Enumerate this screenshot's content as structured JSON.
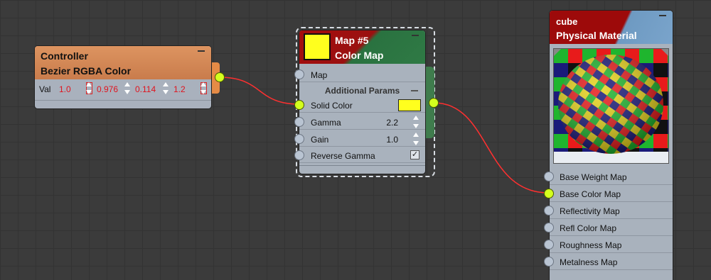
{
  "controller_node": {
    "title": "Controller",
    "subtitle": "Bezier RGBA Color",
    "val_label": "Val",
    "values": [
      "1.0",
      "0.976",
      "0.114",
      "1.2"
    ]
  },
  "color_map_node": {
    "title": "Map #5",
    "subtitle": "Color Map",
    "swatch_color": "#ffff1e",
    "map_label": "Map",
    "group_label": "Additional Params",
    "solid_color_label": "Solid Color",
    "gamma_label": "Gamma",
    "gamma_value": "2.2",
    "gain_label": "Gain",
    "gain_value": "1.0",
    "reverse_gamma_label": "Reverse Gamma"
  },
  "material_node": {
    "title": "cube",
    "subtitle": "Physical Material",
    "maps": [
      "Base Weight Map",
      "Base Color Map",
      "Reflectivity Map",
      "Refl Color Map",
      "Roughness Map",
      "Metalness Map"
    ]
  },
  "colors": {
    "wire": "#ff3030",
    "active_socket": "#d4ff1e",
    "controller_header": "#d98d5a"
  }
}
